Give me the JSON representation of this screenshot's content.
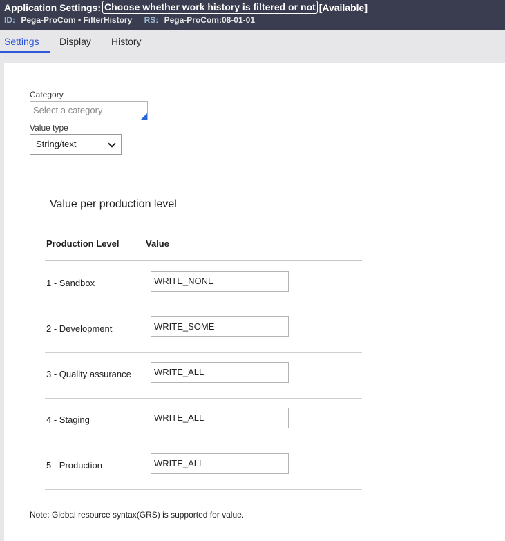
{
  "header": {
    "prefix": "Application Settings:",
    "title": "Choose whether work history is filtered or not",
    "status": "[Available]",
    "id_label": "ID:",
    "id_value": "Pega-ProCom • FilterHistory",
    "rs_label": "RS:",
    "rs_value": "Pega-ProCom:08-01-01"
  },
  "tabs": [
    {
      "label": "Settings",
      "active": true
    },
    {
      "label": "Display",
      "active": false
    },
    {
      "label": "History",
      "active": false
    }
  ],
  "form": {
    "category_label": "Category",
    "category_placeholder": "Select a category",
    "value_type_label": "Value type",
    "value_type_selected": "String/text"
  },
  "section": {
    "title": "Value per production level",
    "col_level": "Production Level",
    "col_value": "Value",
    "rows": [
      {
        "level": "1 - Sandbox",
        "value": "WRITE_NONE"
      },
      {
        "level": "2 - Development",
        "value": "WRITE_SOME"
      },
      {
        "level": "3 - Quality assurance",
        "value": "WRITE_ALL"
      },
      {
        "level": "4 - Staging",
        "value": "WRITE_ALL"
      },
      {
        "level": "5 - Production",
        "value": "WRITE_ALL"
      }
    ]
  },
  "note": "Note: Global resource syntax(GRS) is supported for value.",
  "colors": {
    "header_bg": "#3a3d4f",
    "accent": "#2f57d8"
  }
}
